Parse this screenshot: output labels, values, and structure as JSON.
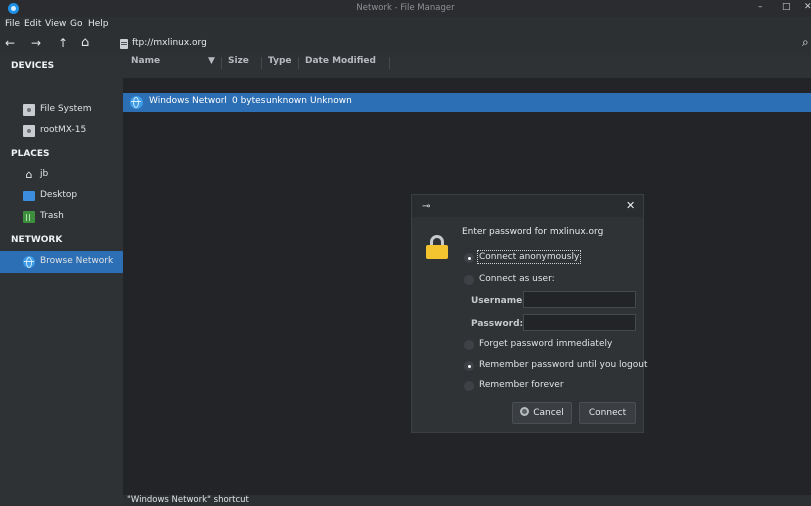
{
  "window": {
    "title": "Network - File Manager",
    "minimize": "–",
    "maximize": "□",
    "close": "✕"
  },
  "menu": [
    "File",
    "Edit",
    "View",
    "Go",
    "Help"
  ],
  "toolbar": {
    "back": "←",
    "forward": "→",
    "up": "↑",
    "home": "⌂",
    "location": "ftp://mxlinux.org",
    "search": "⌕"
  },
  "sidebar": {
    "devices_header": "DEVICES",
    "devices": [
      {
        "label": "File System",
        "icon": "drive-icon"
      },
      {
        "label": "rootMX-15",
        "icon": "drive-icon"
      }
    ],
    "places_header": "PLACES",
    "places": [
      {
        "label": "jb",
        "icon": "home-icon"
      },
      {
        "label": "Desktop",
        "icon": "desktop-icon"
      },
      {
        "label": "Trash",
        "icon": "trash-icon"
      }
    ],
    "network_header": "NETWORK",
    "network": [
      {
        "label": "Browse Network",
        "icon": "globe-icon",
        "selected": true
      }
    ]
  },
  "columns": {
    "name": "Name",
    "size": "Size",
    "type": "Type",
    "modified": "Date Modified"
  },
  "files": [
    {
      "name": "Windows Networl",
      "size": "0 bytes",
      "type": "unknown",
      "modified": "Unknown"
    }
  ],
  "status": "\"Windows Network\" shortcut",
  "dialog": {
    "message": "Enter password for mxlinux.org",
    "close": "✕",
    "connect_anonymously": "Connect anonymously",
    "connect_as_user": "Connect as user:",
    "username_label": "Username:",
    "password_label": "Password:",
    "username_value": "",
    "password_value": "",
    "forget_immediately": "Forget password immediately",
    "remember_until_logout": "Remember password until you logout",
    "remember_forever": "Remember forever",
    "cancel": "Cancel",
    "connect": "Connect"
  },
  "colors": {
    "accent": "#2d6fb5",
    "lock": "#f4c430"
  }
}
